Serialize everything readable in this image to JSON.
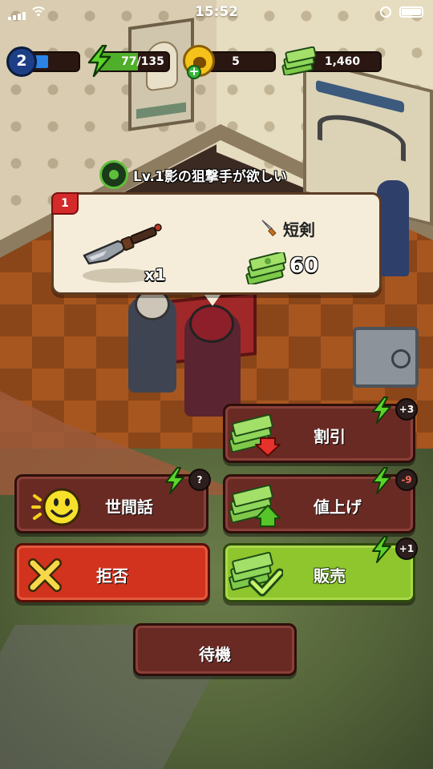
{
  "status_bar": {
    "time": "15:52"
  },
  "hud": {
    "level": "2",
    "level_progress": 0.3,
    "energy": "77/135",
    "energy_progress": 0.57,
    "paws": "5",
    "cash": "1,460"
  },
  "request": {
    "text": "Lv.1影の狙撃手が欲しい"
  },
  "item": {
    "slot": "1",
    "quantity": "x1",
    "category": "短剣",
    "price": "60"
  },
  "actions": {
    "discount": {
      "label": "割引",
      "cost": "+3"
    },
    "chat": {
      "label": "世間話",
      "cost": "?"
    },
    "raise": {
      "label": "値上げ",
      "cost": "-9"
    },
    "reject": {
      "label": "拒否"
    },
    "sell": {
      "label": "販売",
      "cost": "+1"
    },
    "wait": {
      "label": "待機"
    }
  },
  "colors": {
    "energy_green": "#4fae2a",
    "level_blue": "#2a84e8",
    "reject_red": "#d1331e",
    "sell_green": "#8fc52d",
    "button_brown": "#6a2a24"
  },
  "icons": [
    "wifi-icon",
    "battery-icon",
    "energy-bolt-icon",
    "paw-coin-icon",
    "cash-stack-icon",
    "target-icon",
    "dagger-icon",
    "smiley-icon",
    "x-icon",
    "checkmark-icon",
    "arrow-up-icon",
    "arrow-down-icon"
  ]
}
